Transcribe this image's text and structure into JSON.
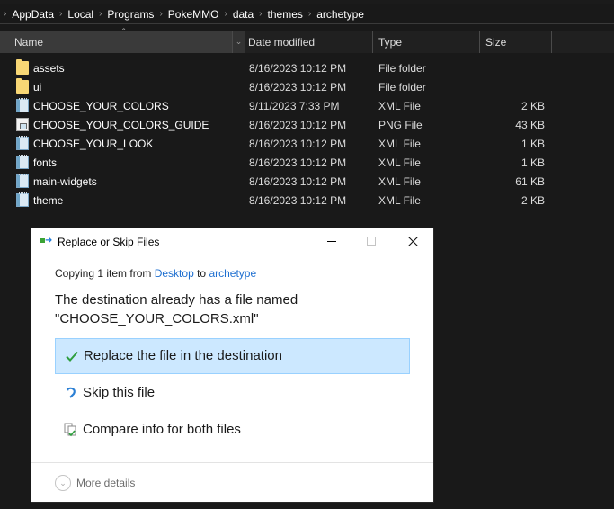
{
  "breadcrumb": [
    "AppData",
    "Local",
    "Programs",
    "PokeMMO",
    "data",
    "themes",
    "archetype"
  ],
  "columns": {
    "name": "Name",
    "date": "Date modified",
    "type": "Type",
    "size": "Size"
  },
  "files": [
    {
      "name": "assets",
      "date": "8/16/2023 10:12 PM",
      "type": "File folder",
      "size": "",
      "icon": "folder-icon"
    },
    {
      "name": "ui",
      "date": "8/16/2023 10:12 PM",
      "type": "File folder",
      "size": "",
      "icon": "folder-icon"
    },
    {
      "name": "CHOOSE_YOUR_COLORS",
      "date": "9/11/2023 7:33 PM",
      "type": "XML File",
      "size": "2 KB",
      "icon": "xml-file-icon"
    },
    {
      "name": "CHOOSE_YOUR_COLORS_GUIDE",
      "date": "8/16/2023 10:12 PM",
      "type": "PNG File",
      "size": "43 KB",
      "icon": "png-file-icon"
    },
    {
      "name": "CHOOSE_YOUR_LOOK",
      "date": "8/16/2023 10:12 PM",
      "type": "XML File",
      "size": "1 KB",
      "icon": "xml-file-icon"
    },
    {
      "name": "fonts",
      "date": "8/16/2023 10:12 PM",
      "type": "XML File",
      "size": "1 KB",
      "icon": "xml-file-icon"
    },
    {
      "name": "main-widgets",
      "date": "8/16/2023 10:12 PM",
      "type": "XML File",
      "size": "61 KB",
      "icon": "xml-file-icon"
    },
    {
      "name": "theme",
      "date": "8/16/2023 10:12 PM",
      "type": "XML File",
      "size": "2 KB",
      "icon": "xml-file-icon"
    }
  ],
  "dialog": {
    "title": "Replace or Skip Files",
    "copying_prefix": "Copying 1 item from ",
    "source": "Desktop",
    "to_word": " to ",
    "destination": "archetype",
    "message_line1": "The destination already has a file named",
    "message_line2": "\"CHOOSE_YOUR_COLORS.xml\"",
    "options": {
      "replace": "Replace the file in the destination",
      "skip": "Skip this file",
      "compare": "Compare info for both files"
    },
    "more_details": "More details",
    "colors": {
      "accent_link": "#1e6fd0",
      "selected_bg": "#cce8ff",
      "check": "#2e9e3e"
    }
  }
}
